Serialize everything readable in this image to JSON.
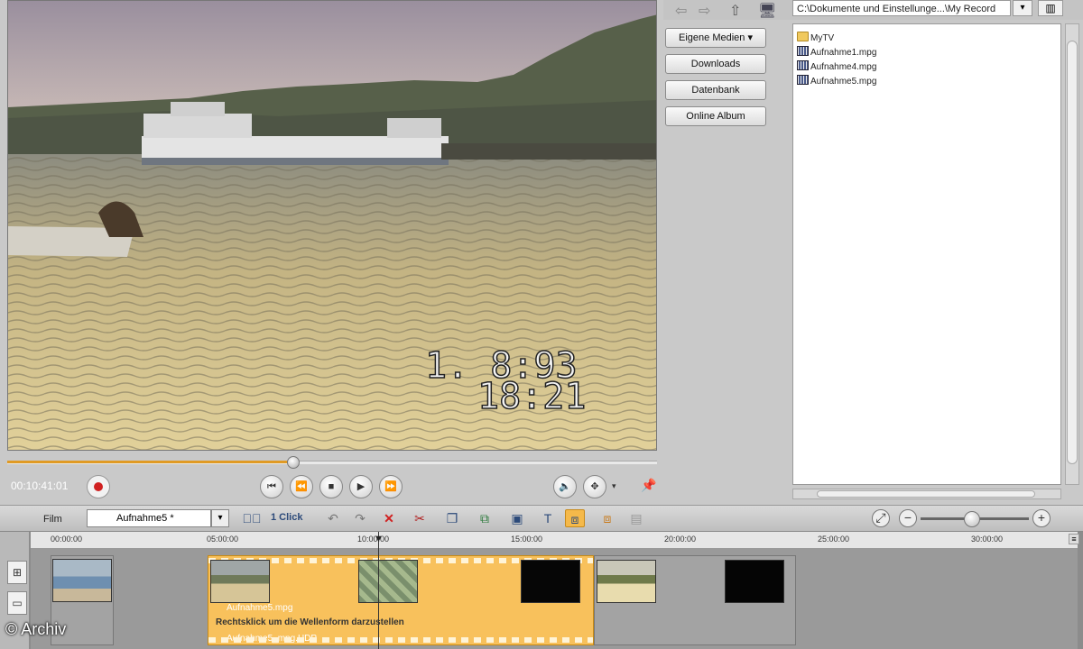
{
  "player": {
    "timecode": "00:10:41:01",
    "osd_date": "1. 8:93",
    "osd_time": "18:21",
    "progress": 0.44
  },
  "browser": {
    "path": "C:\\Dokumente und Einstellunge...\\My Record",
    "sources": [
      {
        "label": "Eigene Medien ▾"
      },
      {
        "label": "Downloads"
      },
      {
        "label": "Datenbank"
      },
      {
        "label": "Online Album"
      }
    ],
    "files": [
      {
        "name": "MyTV",
        "icon": "folder-icon"
      },
      {
        "name": "Aufnahme1.mpg",
        "icon": "video-file-icon"
      },
      {
        "name": "Aufnahme4.mpg",
        "icon": "video-file-icon"
      },
      {
        "name": "Aufnahme5.mpg",
        "icon": "video-file-icon"
      }
    ]
  },
  "toolbar": {
    "film_label": "Film",
    "film_name": "Aufnahme5 *",
    "one_click": "1 Click"
  },
  "timeline": {
    "ticks": [
      "00:00:00",
      "05:00:00",
      "10:00:00",
      "15:00:00",
      "20:00:00",
      "25:00:00",
      "30:00:00"
    ],
    "clip_label": "Aufnahme5.mpg",
    "effect_label": "Rechtsklick um die Wellenform darzustellen",
    "audio_label": "Aufnahme5_mpg.HDP"
  },
  "watermark": "© Archiv",
  "colors": {
    "accent": "#f8c15c",
    "record": "#d02020"
  }
}
